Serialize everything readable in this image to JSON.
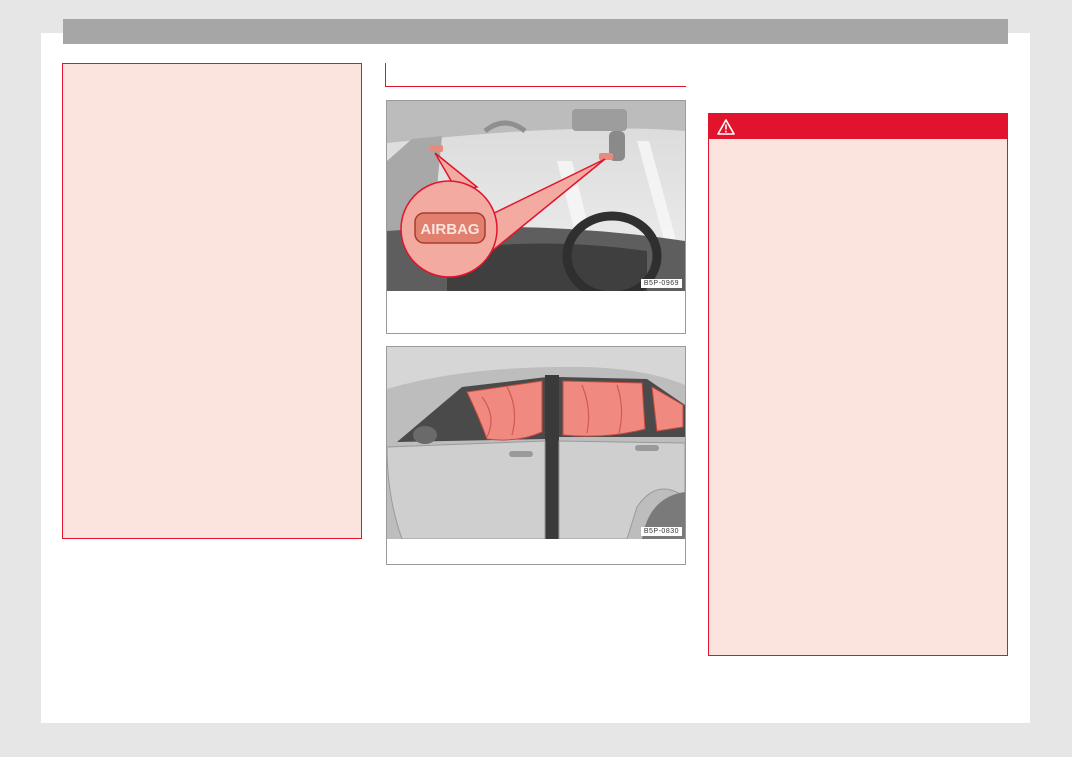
{
  "figures": [
    {
      "code": "B5P-0969",
      "callout_label": "AIRBAG",
      "icon": "airbag-location-illustration"
    },
    {
      "code": "B5P-0830",
      "icon": "curtain-airbag-illustration"
    }
  ],
  "warning": {
    "icon": "warning-triangle-icon"
  },
  "colors": {
    "accent": "#e2142d",
    "warning_bg": "#fbe3de",
    "header_bar": "#a6a6a6",
    "page_bg": "#ffffff"
  }
}
